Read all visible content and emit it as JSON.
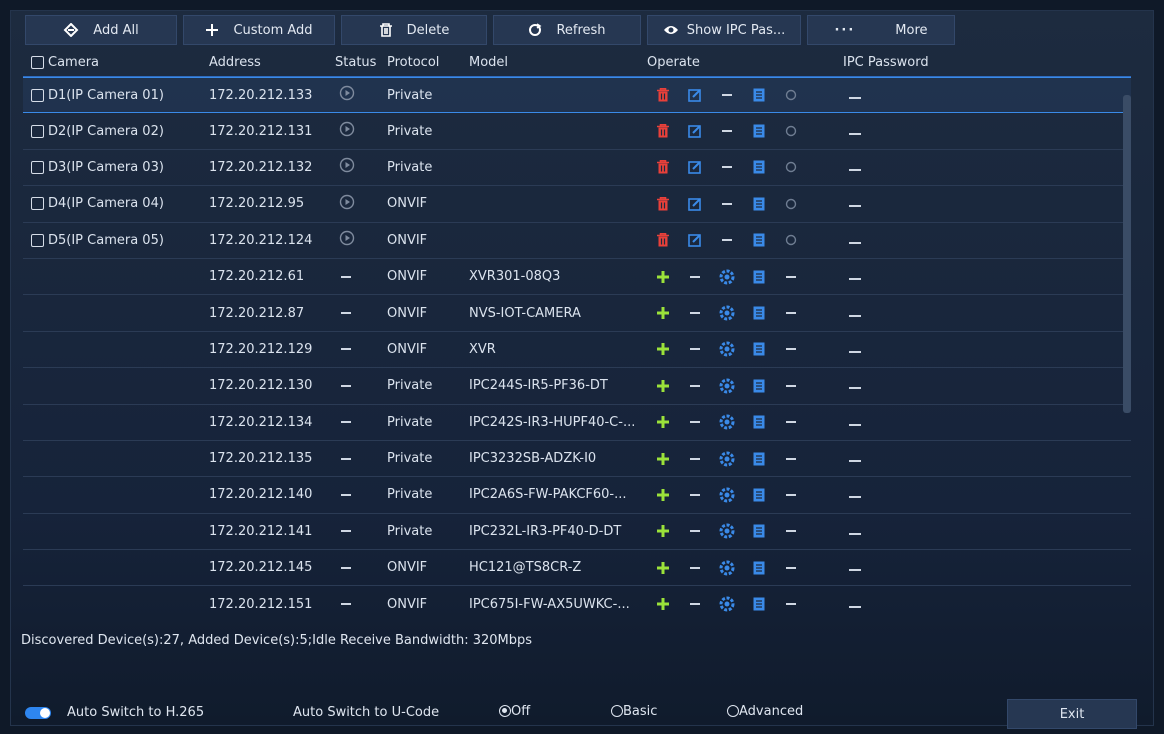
{
  "toolbar": {
    "add_all": "Add All",
    "custom_add": "Custom Add",
    "delete": "Delete",
    "refresh": "Refresh",
    "show_pwd": "Show IPC Pas...",
    "more": "More"
  },
  "table": {
    "headers": {
      "camera": "Camera",
      "address": "Address",
      "status": "Status",
      "protocol": "Protocol",
      "model": "Model",
      "operate": "Operate",
      "ipc_password": "IPC Password"
    },
    "added": [
      {
        "camera": "D1(IP Camera 01)",
        "address": "172.20.212.133",
        "protocol": "Private"
      },
      {
        "camera": "D2(IP Camera 02)",
        "address": "172.20.212.131",
        "protocol": "Private"
      },
      {
        "camera": "D3(IP Camera 03)",
        "address": "172.20.212.132",
        "protocol": "Private"
      },
      {
        "camera": "D4(IP Camera 04)",
        "address": "172.20.212.95",
        "protocol": "ONVIF"
      },
      {
        "camera": "D5(IP Camera 05)",
        "address": "172.20.212.124",
        "protocol": "ONVIF"
      }
    ],
    "discovered": [
      {
        "address": "172.20.212.61",
        "protocol": "ONVIF",
        "model": "XVR301-08Q3"
      },
      {
        "address": "172.20.212.87",
        "protocol": "ONVIF",
        "model": "NVS-IOT-CAMERA"
      },
      {
        "address": "172.20.212.129",
        "protocol": "ONVIF",
        "model": "XVR"
      },
      {
        "address": "172.20.212.130",
        "protocol": "Private",
        "model": "IPC244S-IR5-PF36-DT"
      },
      {
        "address": "172.20.212.134",
        "protocol": "Private",
        "model": "IPC242S-IR3-HUPF40-C-..."
      },
      {
        "address": "172.20.212.135",
        "protocol": "Private",
        "model": "IPC3232SB-ADZK-I0"
      },
      {
        "address": "172.20.212.140",
        "protocol": "Private",
        "model": "IPC2A6S-FW-PAKCF60-..."
      },
      {
        "address": "172.20.212.141",
        "protocol": "Private",
        "model": "IPC232L-IR3-PF40-D-DT"
      },
      {
        "address": "172.20.212.145",
        "protocol": "ONVIF",
        "model": "HC121@TS8CR-Z"
      },
      {
        "address": "172.20.212.151",
        "protocol": "ONVIF",
        "model": "IPC675I-FW-AX5UWKC-..."
      }
    ]
  },
  "status_text": "Discovered Device(s):27, Added Device(s):5;Idle Receive Bandwidth: 320Mbps",
  "bottom": {
    "auto_h265": "Auto Switch to H.265",
    "auto_ucode": "Auto Switch to U-Code",
    "off": "Off",
    "basic": "Basic",
    "advanced": "Advanced",
    "exit": "Exit"
  },
  "colors": {
    "delete_red": "#e8403a",
    "edit_blue": "#3a8ae8",
    "add_green": "#9be23a",
    "accent": "#2e86f0"
  }
}
